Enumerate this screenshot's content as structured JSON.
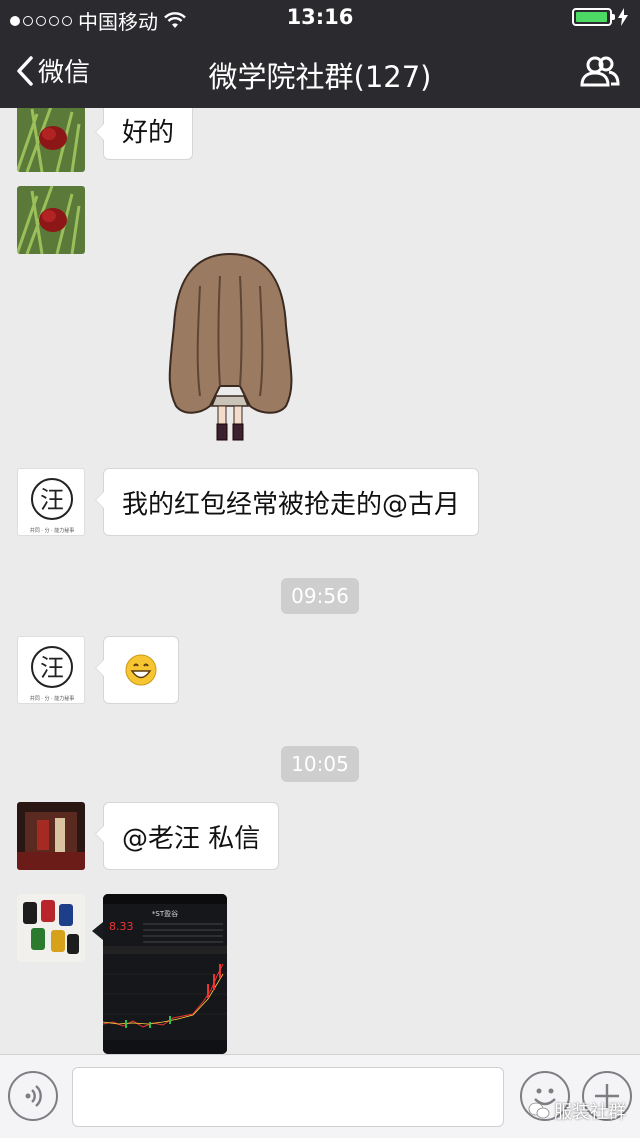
{
  "status_bar": {
    "carrier": "中国移动",
    "time": "13:16",
    "battery_color": "#4cd964"
  },
  "nav": {
    "back_label": "微信",
    "title": "微学院社群(127)",
    "members_icon": "group-members-icon"
  },
  "messages": [
    {
      "type": "text",
      "text": "好的"
    },
    {
      "type": "sticker",
      "description_icon": "long-hair-girl-sticker"
    },
    {
      "type": "text",
      "text": "我的红包经常被抢走的@古月"
    },
    {
      "type": "timestamp",
      "text": "09:56"
    },
    {
      "type": "emoji",
      "icon": "grinning-face-emoji"
    },
    {
      "type": "timestamp",
      "text": "10:05"
    },
    {
      "type": "text",
      "text": "@老汪 私信"
    },
    {
      "type": "image",
      "icon": "stock-chart-screenshot",
      "stock_code": "*ST盈谷",
      "price": "8.33"
    }
  ],
  "avatars": {
    "wang_char": "汪",
    "wang_caption": "共同 · 分 · 能力秘事"
  },
  "input_bar": {
    "voice_icon": "voice-icon",
    "emoji_icon": "emoji-icon",
    "plus_icon": "plus-icon"
  },
  "watermark": "服装社群"
}
